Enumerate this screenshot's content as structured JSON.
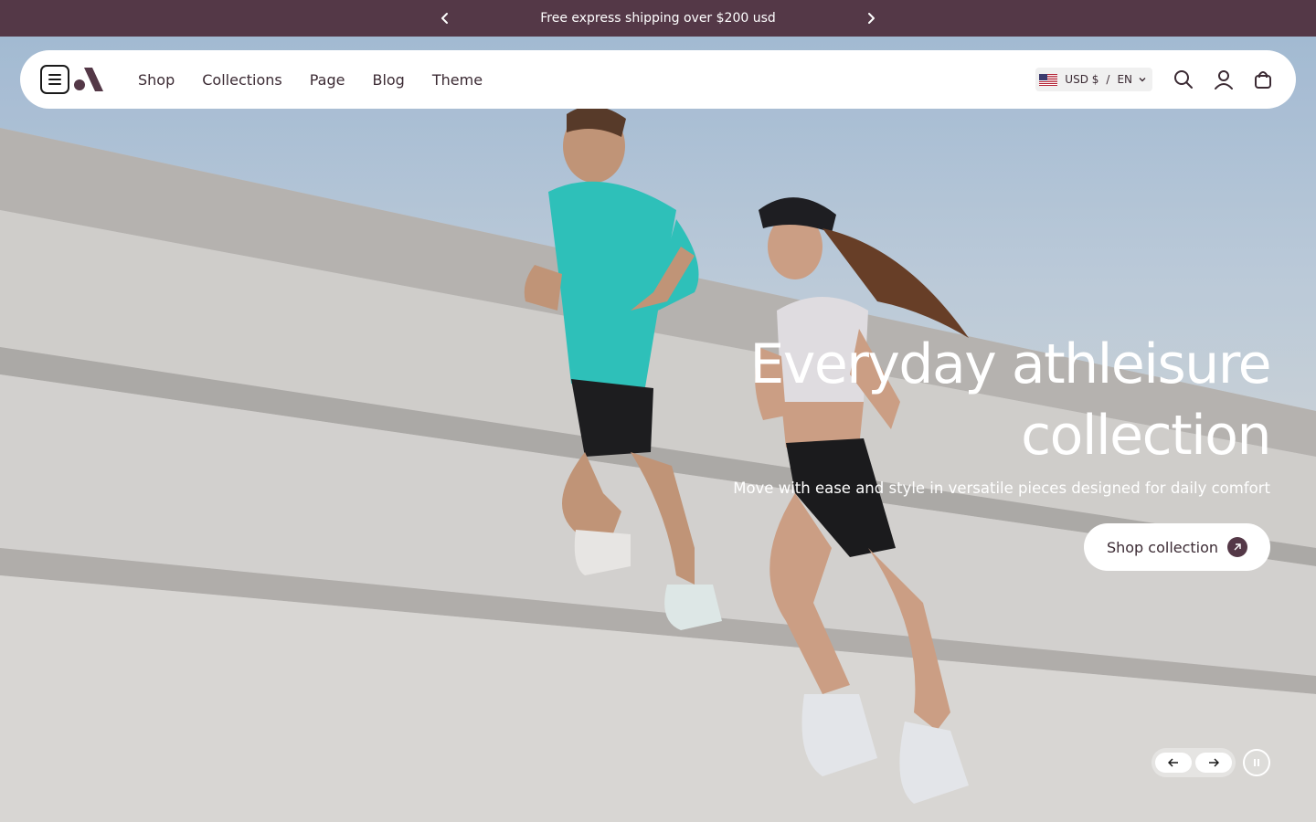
{
  "announcement": {
    "text": "Free express shipping over $200 usd",
    "prev_icon": "chevron-left-icon",
    "next_icon": "chevron-right-icon"
  },
  "header": {
    "menu_icon": "menu-icon",
    "logo_icon": "brand-logo",
    "nav": [
      {
        "label": "Shop"
      },
      {
        "label": "Collections"
      },
      {
        "label": "Page"
      },
      {
        "label": "Blog"
      },
      {
        "label": "Theme"
      }
    ],
    "locale": {
      "flag": "us-flag-icon",
      "currency": "USD $",
      "separator": "/",
      "language": "EN"
    },
    "icons": [
      "search-icon",
      "account-icon",
      "cart-icon"
    ]
  },
  "hero": {
    "title_line1": "Everyday athleisure",
    "title_line2": "collection",
    "subtitle": "Move with ease and style in versatile pieces designed for daily comfort",
    "cta_label": "Shop collection",
    "cta_icon": "arrow-up-right-icon",
    "image": "two-runners-on-stadium-steps"
  },
  "slider": {
    "prev_icon": "arrow-left-icon",
    "next_icon": "arrow-right-icon",
    "pause_icon": "pause-icon"
  },
  "colors": {
    "brand": "#543847",
    "header_bg": "#ffffff",
    "text_dark": "#3b2a33",
    "accent_teal": "#2fc9c1"
  }
}
